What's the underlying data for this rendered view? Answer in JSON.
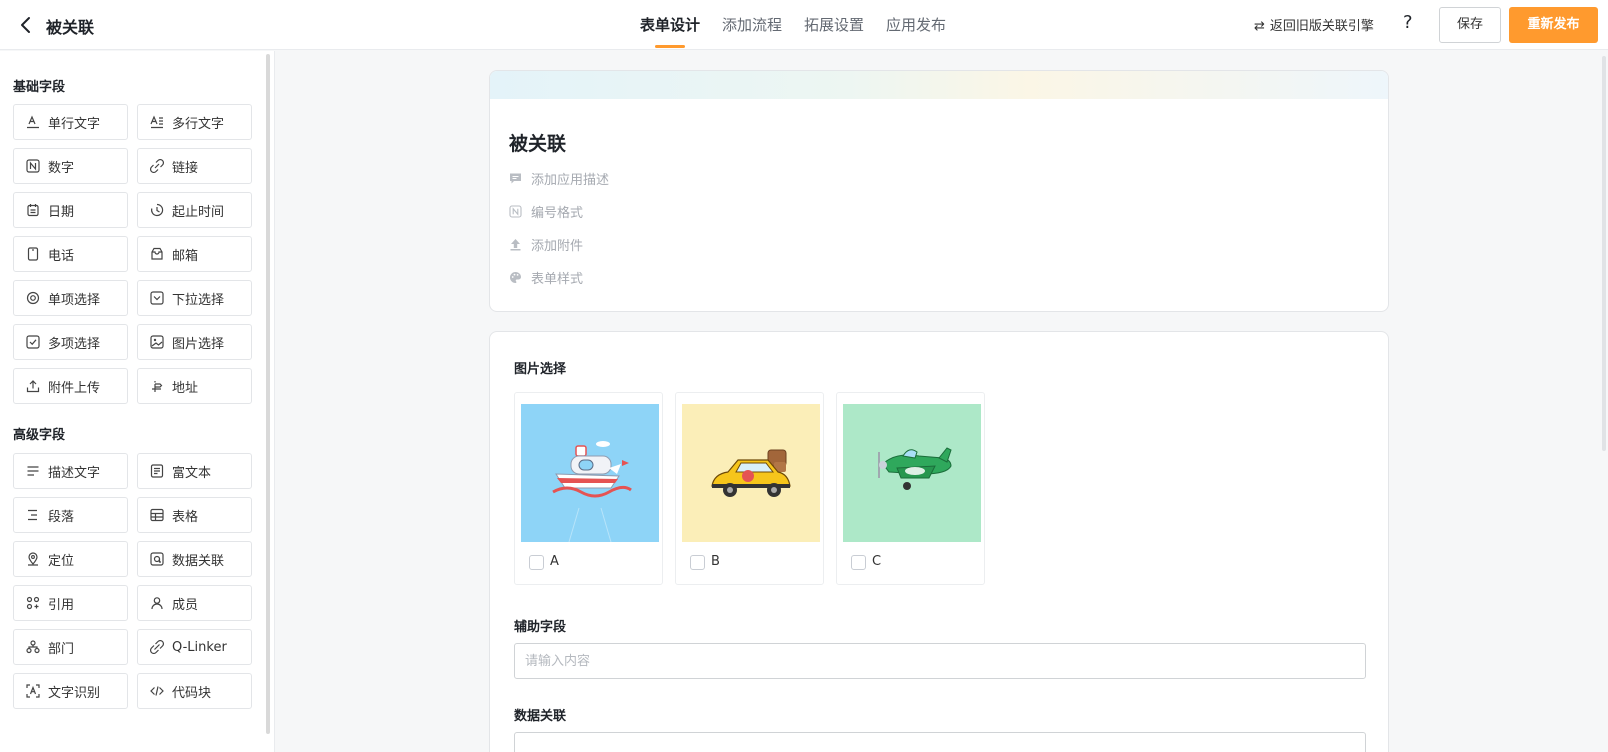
{
  "header": {
    "back_label": "",
    "app_title": "被关联",
    "tabs": [
      {
        "label": "表单设计",
        "active": true
      },
      {
        "label": "添加流程",
        "active": false
      },
      {
        "label": "拓展设置",
        "active": false
      },
      {
        "label": "应用发布",
        "active": false
      }
    ],
    "legacy_link": "返回旧版关联引擎",
    "help": "?",
    "save_label": "保存",
    "publish_label": "重新发布",
    "accent_color": "#ff9a2e"
  },
  "sidebar": {
    "basic_title": "基础字段",
    "basic_fields": [
      {
        "label": "单行文字",
        "icon": "single-line-text-icon"
      },
      {
        "label": "多行文字",
        "icon": "multi-line-text-icon"
      },
      {
        "label": "数字",
        "icon": "number-icon"
      },
      {
        "label": "链接",
        "icon": "link-icon"
      },
      {
        "label": "日期",
        "icon": "calendar-icon"
      },
      {
        "label": "起止时间",
        "icon": "time-range-icon"
      },
      {
        "label": "电话",
        "icon": "phone-icon"
      },
      {
        "label": "邮箱",
        "icon": "mail-icon"
      },
      {
        "label": "单项选择",
        "icon": "radio-icon"
      },
      {
        "label": "下拉选择",
        "icon": "dropdown-icon"
      },
      {
        "label": "多项选择",
        "icon": "checkbox-icon"
      },
      {
        "label": "图片选择",
        "icon": "image-icon"
      },
      {
        "label": "附件上传",
        "icon": "upload-icon"
      },
      {
        "label": "地址",
        "icon": "location-icon"
      }
    ],
    "advanced_title": "高级字段",
    "advanced_fields": [
      {
        "label": "描述文字",
        "icon": "description-icon"
      },
      {
        "label": "富文本",
        "icon": "rich-text-icon"
      },
      {
        "label": "段落",
        "icon": "paragraph-icon"
      },
      {
        "label": "表格",
        "icon": "table-icon"
      },
      {
        "label": "定位",
        "icon": "pin-icon"
      },
      {
        "label": "数据关联",
        "icon": "data-link-icon"
      },
      {
        "label": "引用",
        "icon": "reference-icon"
      },
      {
        "label": "成员",
        "icon": "member-icon"
      },
      {
        "label": "部门",
        "icon": "department-icon"
      },
      {
        "label": "Q-Linker",
        "icon": "q-linker-icon"
      },
      {
        "label": "文字识别",
        "icon": "ocr-icon"
      },
      {
        "label": "代码块",
        "icon": "code-icon"
      }
    ]
  },
  "form": {
    "title": "被关联",
    "header_actions": [
      {
        "label": "添加应用描述",
        "icon": "comment-icon"
      },
      {
        "label": "编号格式",
        "icon": "number-format-icon"
      },
      {
        "label": "添加附件",
        "icon": "attach-upload-icon"
      },
      {
        "label": "表单样式",
        "icon": "palette-icon"
      }
    ],
    "picture_field": {
      "label": "图片选择",
      "options": [
        {
          "label": "A",
          "bg": "#8ed4f7",
          "picture": "ship"
        },
        {
          "label": "B",
          "bg": "#fbeeb8",
          "picture": "taxi"
        },
        {
          "label": "C",
          "bg": "#ade8c8",
          "picture": "airplane"
        }
      ]
    },
    "aux_field": {
      "label": "辅助字段",
      "placeholder": "请输入内容"
    },
    "assoc_field": {
      "label": "数据关联"
    }
  }
}
